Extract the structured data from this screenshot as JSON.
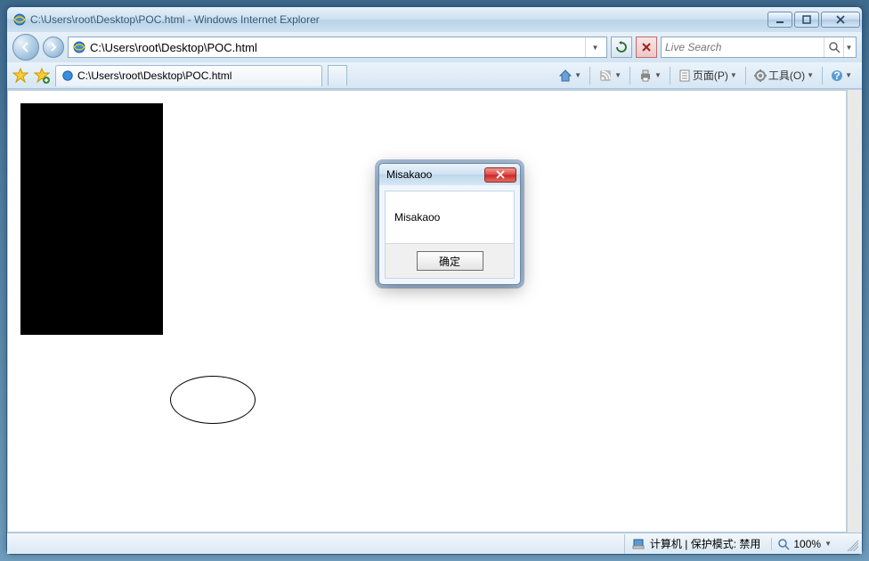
{
  "window": {
    "title": "C:\\Users\\root\\Desktop\\POC.html - Windows Internet Explorer"
  },
  "nav": {
    "address": "C:\\Users\\root\\Desktop\\POC.html",
    "search_placeholder": "Live Search"
  },
  "tab": {
    "label": "C:\\Users\\root\\Desktop\\POC.html"
  },
  "toolbar": {
    "page_label": "页面(P)",
    "tools_label": "工具(O)"
  },
  "dialog": {
    "title": "Misakaoo",
    "message": "Misakaoo",
    "ok_label": "确定"
  },
  "status": {
    "zone_label": "计算机 | 保护模式: 禁用",
    "zoom": "100%"
  }
}
